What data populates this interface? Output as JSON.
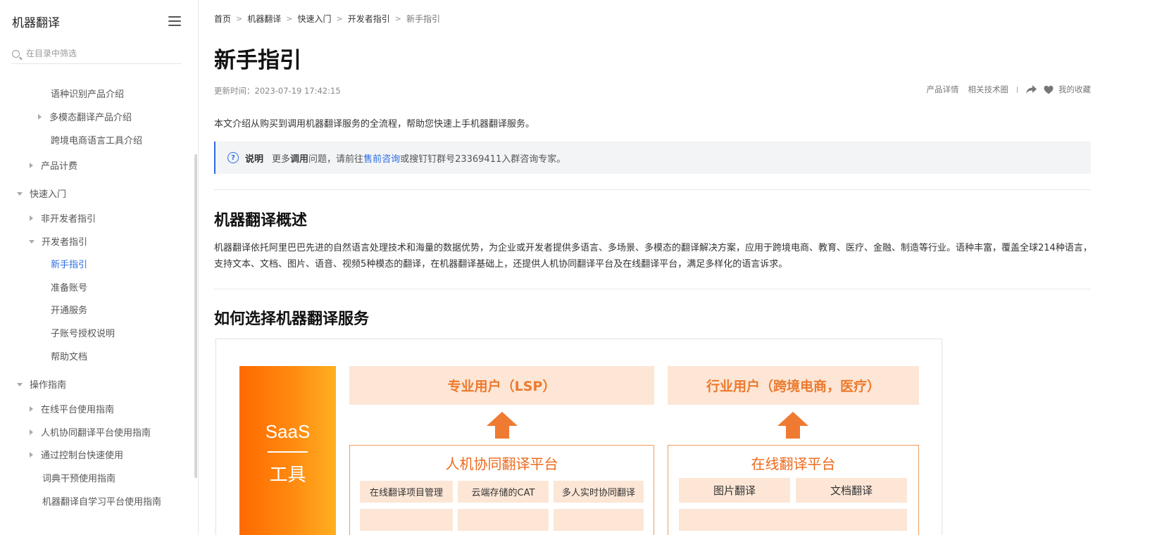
{
  "sidebar": {
    "title": "机器翻译",
    "search_placeholder": "在目录中筛选",
    "items": [
      {
        "label": "语种识别产品介绍"
      },
      {
        "label": "多模态翻译产品介绍"
      },
      {
        "label": "跨境电商语言工具介绍"
      },
      {
        "label": "产品计费"
      },
      {
        "label": "快速入门"
      },
      {
        "label": "非开发者指引"
      },
      {
        "label": "开发者指引"
      },
      {
        "label": "新手指引"
      },
      {
        "label": "准备账号"
      },
      {
        "label": "开通服务"
      },
      {
        "label": "子账号授权说明"
      },
      {
        "label": "帮助文档"
      },
      {
        "label": "操作指南"
      },
      {
        "label": "在线平台使用指南"
      },
      {
        "label": "人机协同翻译平台使用指南"
      },
      {
        "label": "通过控制台快速使用"
      },
      {
        "label": "词典干预使用指南"
      },
      {
        "label": "机器翻译自学习平台使用指南"
      }
    ]
  },
  "breadcrumb": [
    "首页",
    "机器翻译",
    "快速入门",
    "开发者指引",
    "新手指引"
  ],
  "page": {
    "title": "新手指引",
    "update_time": "更新时间：2023-07-19 17:42:15",
    "actions": {
      "product_detail": "产品详情",
      "tech_circle": "相关技术圈",
      "favorite": "我的收藏"
    },
    "intro": "本文介绍从购买到调用机器翻译服务的全流程，帮助您快速上手机器翻译服务。",
    "note": {
      "label": "说明",
      "text_before": "更多",
      "text_bold": "调用",
      "text_mid": "问题，请前往",
      "link": "售前咨询",
      "text_after": "或搜钉钉群号23369411入群咨询专家。"
    },
    "section1_title": "机器翻译概述",
    "section1_body": "机器翻译依托阿里巴巴先进的自然语言处理技术和海量的数据优势，为企业或开发者提供多语言、多场景、多模态的翻译解决方案，应用于跨境电商、教育、医疗、金融、制造等行业。语种丰富，覆盖全球214种语言，支持文本、文档、图片、语音、视频5种模态的翻译，在机器翻译基础上，还提供人机协同翻译平台及在线翻译平台，满足多样化的语言诉求。",
    "section2_title": "如何选择机器翻译服务"
  },
  "diagram": {
    "saas_top": "SaaS",
    "saas_bottom": "工具",
    "user_lsp": "专业用户（LSP）",
    "user_industry": "行业用户（跨境电商，医疗）",
    "platform_left": {
      "title": "人机协同翻译平台",
      "chips": [
        "在线翻译项目管理",
        "云端存储的CAT",
        "多人实时协同翻译"
      ]
    },
    "platform_right": {
      "title": "在线翻译平台",
      "chips": [
        "图片翻译",
        "文档翻译"
      ]
    },
    "colors": {
      "accent": "#ff6a00",
      "chip_bg": "#fde6d6",
      "arrow": "#ef7a32",
      "link": "#2b6de4"
    }
  }
}
